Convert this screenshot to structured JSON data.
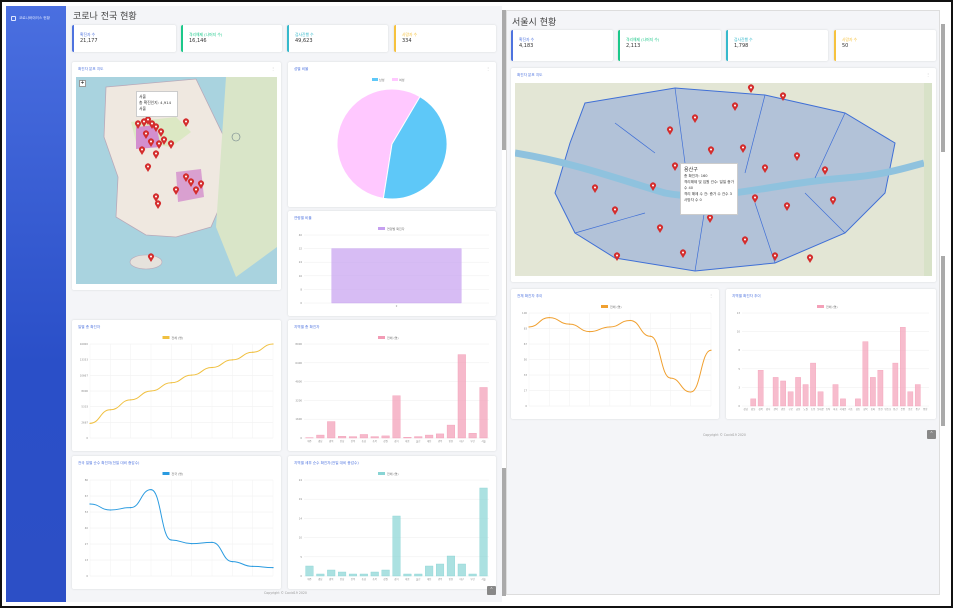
{
  "sidebar": {
    "brand": "코로나바이러스 현황"
  },
  "left": {
    "title": "코로나 전국 현황",
    "stats": [
      {
        "label": "확진자 수",
        "value": "21,177",
        "color": "#4e73df"
      },
      {
        "label": "격리해제 (나머지 수)",
        "value": "16,146",
        "color": "#1cc88a"
      },
      {
        "label": "검사진행 수",
        "value": "49,623",
        "color": "#36b9cc"
      },
      {
        "label": "사망자 수",
        "value": "334",
        "color": "#f6c23e"
      }
    ],
    "map_title": "확진자 분포 지도",
    "map_popup": {
      "title": "서울",
      "text": "총 확진인지: 4,914",
      "sub": "서울"
    },
    "pie_title": "성별 비율",
    "pie_legend": [
      "남성",
      "여성"
    ],
    "age_title": "연령별 비율",
    "age_legend": "연령별 확진자",
    "date_title": "일별 총 확진자",
    "date_legend": "전체 (명)",
    "region_title": "지역별 총 확진자",
    "region_legend": "전체 (명)",
    "recent_title": "전국 일별 순수 확진자(전일 대비 증감수)",
    "recent_legend": "전국 (명)",
    "region_recent_title": "지역별 세부 순수 확진자(전일 대비 증감수)",
    "region_recent_legend": "전체 (명)",
    "footer": "Copyright © Covid19 2020"
  },
  "right": {
    "title": "서울시 현황",
    "stats": [
      {
        "label": "확진자 수",
        "value": "4,183",
        "color": "#4e73df"
      },
      {
        "label": "격리해제 (나머지 수)",
        "value": "2,113",
        "color": "#1cc88a"
      },
      {
        "label": "검사진행 수",
        "value": "1,798",
        "color": "#36b9cc"
      },
      {
        "label": "사망자 수",
        "value": "50",
        "color": "#f6c23e"
      }
    ],
    "map_title": "확진자 분포 지도",
    "map_popup": {
      "title": "용산구",
      "lines": [
        "총 확진자: 160",
        "격리해제 및 입원 건수: 일일 증가 수 40",
        "격리 해제 수 건: 증가 수 건수 3",
        "사망자 수 0"
      ]
    },
    "trend_title": "전체 확진자 추이",
    "trend_legend": "전체 (명)",
    "gu_title": "지역별 확진자 추이",
    "gu_legend": "전체 (명)",
    "footer": "Copyright © Covid19 2020"
  },
  "chart_data": [
    {
      "type": "pie",
      "title": "성별 비율",
      "series": [
        {
          "name": "남성",
          "values": [
            44
          ]
        },
        {
          "name": "여성",
          "values": [
            56
          ]
        }
      ],
      "colors": [
        "#5ec8f8",
        "#ffc8ff"
      ]
    },
    {
      "type": "bar",
      "title": "연령별 비율",
      "categories": [
        "0"
      ],
      "values": [
        32
      ],
      "ylim": [
        0,
        40
      ]
    },
    {
      "type": "line",
      "title": "일별 총 확진자",
      "x": [
        1,
        2,
        3,
        4,
        5,
        6,
        7,
        8,
        9,
        10
      ],
      "values": [
        2500,
        4800,
        6500,
        8000,
        9400,
        10700,
        12000,
        13300,
        14600,
        16000
      ],
      "ylim": [
        0,
        16000
      ]
    },
    {
      "type": "bar",
      "title": "지역별 총 확진자",
      "categories": [
        "제주",
        "경남",
        "경북",
        "전남",
        "전북",
        "충남",
        "충북",
        "강원",
        "경기",
        "세종",
        "울산",
        "대전",
        "광주",
        "인천",
        "대구",
        "부산",
        "서울"
      ],
      "values": [
        30,
        250,
        1400,
        150,
        120,
        300,
        120,
        180,
        3600,
        60,
        120,
        250,
        350,
        1100,
        7100,
        400,
        4300
      ],
      "ylim": [
        0,
        8000
      ]
    },
    {
      "type": "line",
      "title": "전국 일별 순수 확진자",
      "x": [
        1,
        2,
        3,
        4,
        5,
        6,
        7,
        8,
        9,
        10
      ],
      "values": [
        60,
        55,
        57,
        72,
        30,
        27,
        28,
        12,
        8,
        7
      ],
      "ylim": [
        0,
        80
      ]
    },
    {
      "type": "bar",
      "title": "지역별 세부 순수 확진자",
      "categories": [
        "제주",
        "경남",
        "경북",
        "전남",
        "전북",
        "충남",
        "충북",
        "강원",
        "경기",
        "세종",
        "울산",
        "대전",
        "광주",
        "인천",
        "대구",
        "부산",
        "서울"
      ],
      "values": [
        2.5,
        0.5,
        1.5,
        1,
        0.5,
        0.5,
        1,
        1.5,
        15,
        0.5,
        0.5,
        2.5,
        3,
        5,
        3,
        0.5,
        22
      ],
      "ylim": [
        0,
        24
      ]
    },
    {
      "type": "line",
      "title": "전체 확진자 추이",
      "x": [
        1,
        2,
        3,
        4,
        5,
        6,
        7,
        8,
        9,
        10
      ],
      "values": [
        85,
        95,
        88,
        80,
        85,
        92,
        75,
        30,
        15,
        60
      ],
      "ylim": [
        0,
        100
      ]
    },
    {
      "type": "bar",
      "title": "지역별 확진자 추이",
      "categories": [
        "강남",
        "강동",
        "강북",
        "강서",
        "관악",
        "광진",
        "구로",
        "금천",
        "노원",
        "도봉",
        "동대문",
        "동작",
        "마포",
        "서대문",
        "서초",
        "성동",
        "성북",
        "송파",
        "양천",
        "영등포",
        "용산",
        "은평",
        "종로",
        "중구",
        "중랑"
      ],
      "values": [
        0,
        1,
        5,
        0,
        4,
        3.5,
        2,
        4,
        3,
        6,
        2,
        0,
        3,
        1,
        0,
        1,
        9,
        4,
        5,
        0,
        6,
        11,
        2,
        3,
        0
      ],
      "ylim": [
        0,
        13
      ]
    }
  ]
}
